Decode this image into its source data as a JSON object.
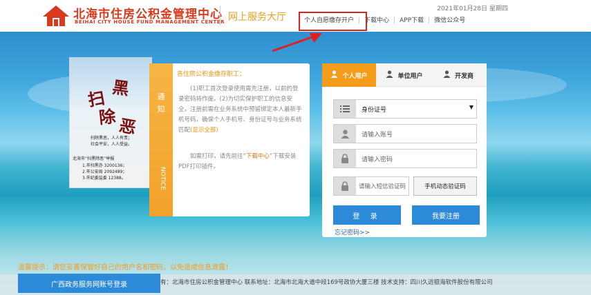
{
  "header": {
    "logo_title": "北海市住房公积金管理中心",
    "logo_sub": "BEIHAI CITY HOUSE FUND MANAGEMENT CENTER",
    "hall_title": "网上服务大厅",
    "date": "2021年01月28日",
    "weekday": "星期四",
    "nav": [
      "个人自愿缴存开户",
      "下载中心",
      "APP下载",
      "微信公众号"
    ]
  },
  "poster": {
    "chars": [
      "扫",
      "黑",
      "除",
      "恶"
    ],
    "slogan1": "扫除黑恶，人人有责；",
    "slogan2": "社会平安，人人受益。",
    "hotline_title": "北海市“扫黑除恶”举报",
    "hotline1": "1.市扫黑办 3200136；",
    "hotline2": "2.市公安局 2092489；",
    "hotline3": "3.市纪委监委 12388。"
  },
  "notice": {
    "tab_notice": "通知",
    "tab_notice_en": "NOTICE",
    "heading": "各住房公积金缴存职工：",
    "body": "(1)职工首次登录使用需先注册，以前的登录密码将作废。(2)为切实保护职工的信息安全，注册前需在业务系统中预留绑定本人最新手机号码，确保个人手机号、身份证号与业务系统匹配",
    "show_all": "(显示全部)",
    "print_prefix": "如需打印，请先前往“",
    "print_link": "下载中心",
    "print_suffix": "”下载安装PDF打印插件。"
  },
  "login": {
    "tabs": [
      "个人用户",
      "单位用户",
      "开发商"
    ],
    "id_type": "身份证号",
    "account_placeholder": "请输入账号",
    "password_placeholder": "请输入密码",
    "sms_placeholder": "请输入短信验证码",
    "sms_button": "手机动态验证码",
    "login_button": "登 录",
    "register_button": "我要注册",
    "forgot": "忘记密码>>"
  },
  "bottom": {
    "warning": "温馨提示：请您妥善保管好自己的用户名和密码，以免造成信息泄露！",
    "footer": "有：北海市住房公积金管理中心 联系地址：北海市北海大道中段169号政协大厦三楼 技术支持：四川久远银海软件股份有限公司",
    "gx_button": "广西政务服务网账号登录"
  },
  "colors": {
    "accent": "#f39d1b",
    "primary": "#2c8ad9",
    "brand": "#d9391c",
    "highlight": "#e02020"
  }
}
